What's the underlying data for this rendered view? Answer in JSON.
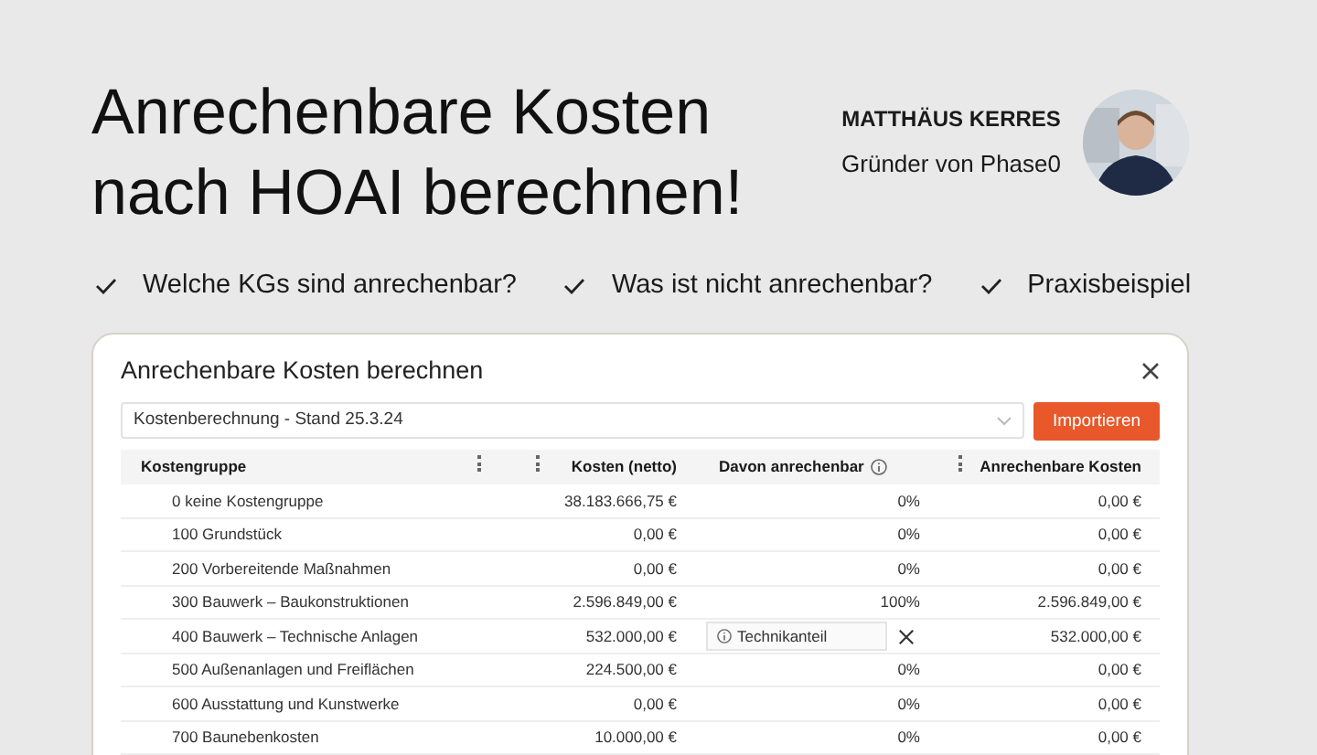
{
  "headline": [
    "Anrechenbare Kosten",
    "nach HOAI berechnen!"
  ],
  "author": {
    "name": "MATTHÄUS KERRES",
    "role": "Gründer von Phase0"
  },
  "checks": [
    "Welche KGs sind anrechenbar?",
    "Was ist nicht anrechenbar?",
    "Praxisbeispiel"
  ],
  "dialog": {
    "title": "Anrechenbare Kosten berechnen",
    "select": {
      "value": "Kostenberechnung - Stand 25.3.24"
    },
    "button": "Importieren",
    "table": {
      "columns": [
        "Kostengruppe",
        "Kosten (netto)",
        "Davon anrechenbar",
        "Anrechenbare Kosten"
      ],
      "rows": [
        {
          "kind": "percent",
          "group": "0 keine Kostengruppe",
          "cost": "38.183.666,75 €",
          "share": "0%",
          "eligible": "0,00 €"
        },
        {
          "kind": "percent",
          "group": "100 Grundstück",
          "cost": "0,00 €",
          "share": "0%",
          "eligible": "0,00 €"
        },
        {
          "kind": "percent",
          "group": "200 Vorbereitende Maßnahmen",
          "cost": "0,00 €",
          "share": "0%",
          "eligible": "0,00 €"
        },
        {
          "kind": "percent",
          "group": "300 Bauwerk – Baukonstruktionen",
          "cost": "2.596.849,00 €",
          "share": "100%",
          "eligible": "2.596.849,00 €"
        },
        {
          "kind": "chip",
          "group": "400 Bauwerk – Technische Anlagen",
          "cost": "532.000,00 €",
          "share": "Technikanteil",
          "eligible": "532.000,00 €"
        },
        {
          "kind": "percent",
          "group": "500 Außenanlagen und Freiflächen",
          "cost": "224.500,00 €",
          "share": "0%",
          "eligible": "0,00 €"
        },
        {
          "kind": "percent",
          "group": "600 Ausstattung und Kunstwerke",
          "cost": "0,00 €",
          "share": "0%",
          "eligible": "0,00 €"
        },
        {
          "kind": "percent",
          "group": "700 Baunebenkosten",
          "cost": "10.000,00 €",
          "share": "0%",
          "eligible": "0,00 €"
        }
      ]
    }
  }
}
